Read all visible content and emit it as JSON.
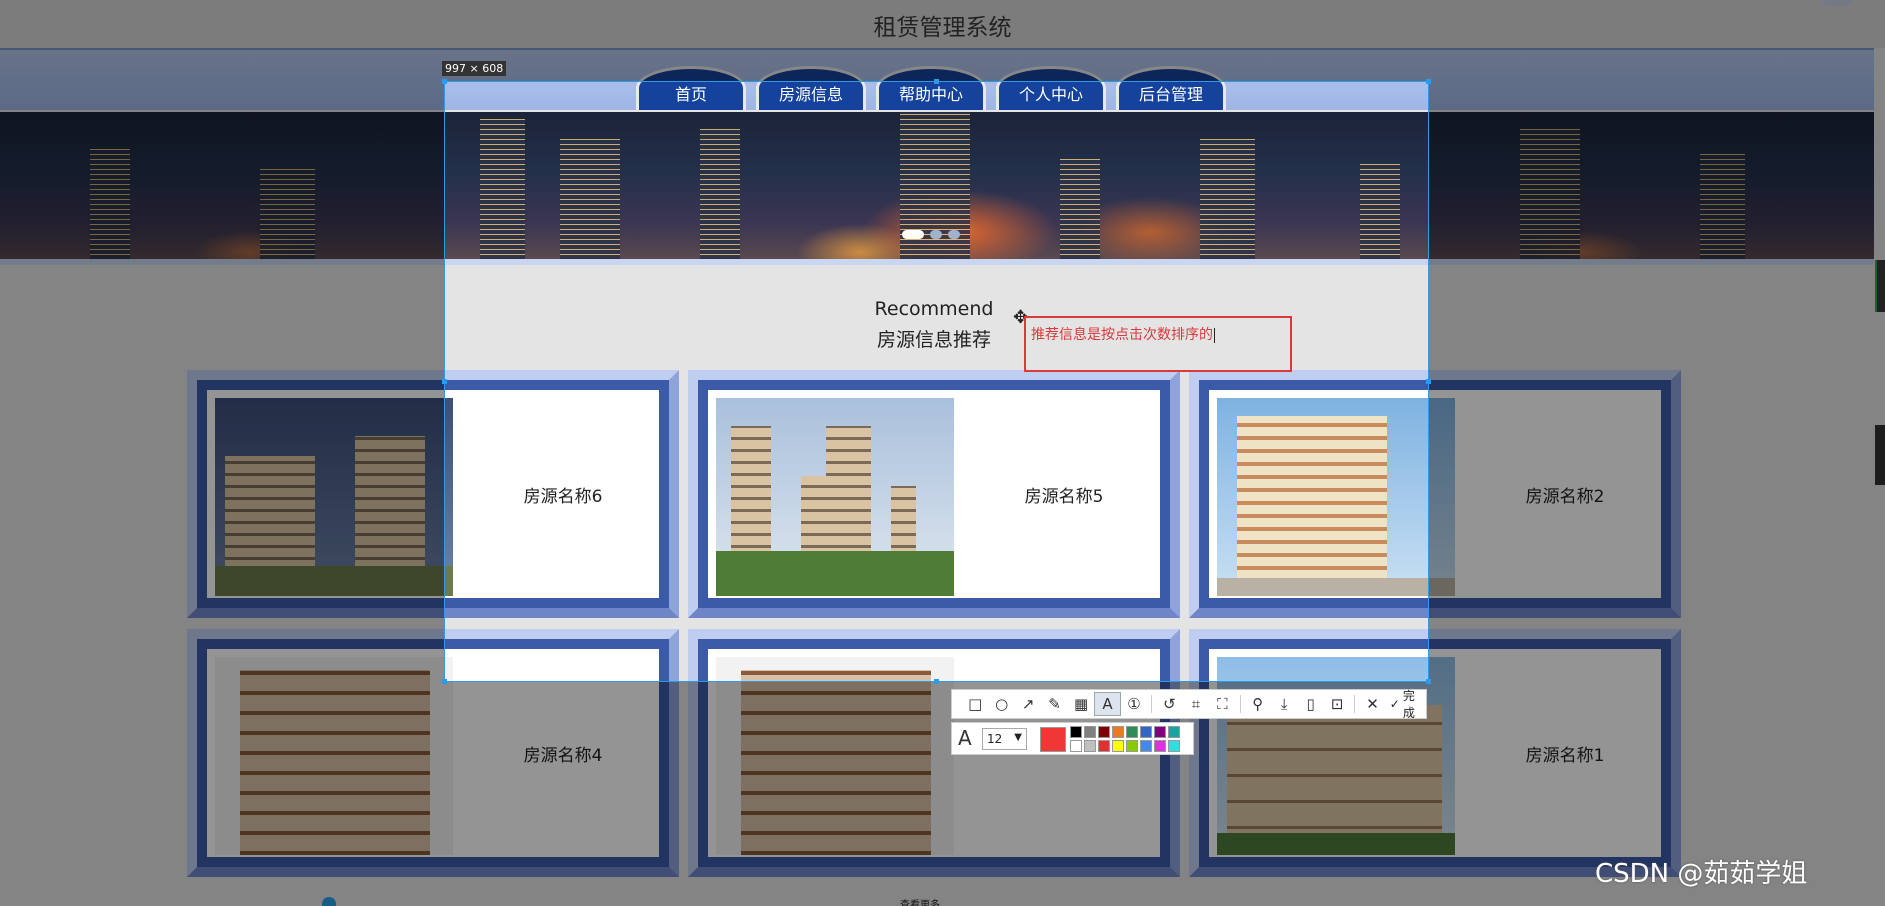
{
  "page": {
    "title": "租赁管理系统",
    "nav": [
      "首页",
      "房源信息",
      "帮助中心",
      "个人中心",
      "后台管理"
    ]
  },
  "recommend": {
    "en": "Recommend",
    "cn": "房源信息推荐"
  },
  "listings": [
    {
      "name": "房源名称6",
      "photo": "apartment-blocks"
    },
    {
      "name": "房源名称5",
      "photo": "high-rise-towers"
    },
    {
      "name": "房源名称2",
      "photo": "residential-tower"
    },
    {
      "name": "房源名称4",
      "photo": "mid-rise-building"
    },
    {
      "name": "",
      "photo": "mid-rise-building"
    },
    {
      "name": "房源名称1",
      "photo": "villa"
    }
  ],
  "bottom_hint": "查看更多",
  "capture": {
    "size_label": "997 × 608",
    "annotation_text": "推荐信息是按点击次数排序的",
    "annotation_color": "#d93a3a",
    "tools": [
      "rectangle-icon",
      "ellipse-icon",
      "arrow-icon",
      "pen-icon",
      "mosaic-icon",
      "text-icon",
      "serial-number-icon",
      "undo-icon",
      "ocr-icon",
      "scan-icon",
      "pin-icon",
      "save-icon",
      "long-screenshot-icon",
      "bookmark-icon",
      "close-icon"
    ],
    "done_label": "完成",
    "font_size": "12",
    "current_color": "#f03636",
    "palette": [
      "#000000",
      "#808080",
      "#800000",
      "#e87a2a",
      "#2e8b57",
      "#3366cc",
      "#800080",
      "#20a0a0",
      "#ffffff",
      "#c0c0c0",
      "#e03030",
      "#ffff00",
      "#88cc00",
      "#4488ee",
      "#dd33dd",
      "#33dddd"
    ]
  },
  "watermark": "CSDN @茹茹学姐"
}
